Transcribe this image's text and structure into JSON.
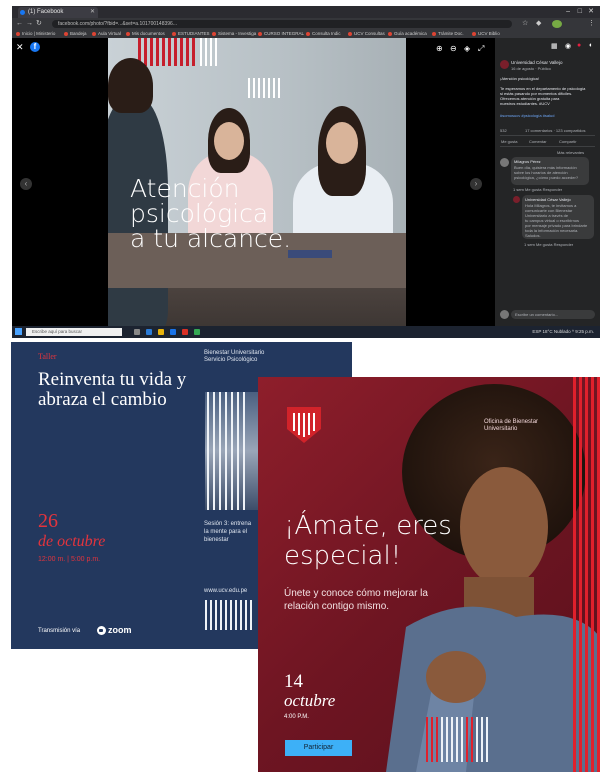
{
  "browser": {
    "tab_title": "(1) Facebook",
    "url": "facebook.com/photo/?fbid=...&set=a.101700148396...",
    "bookmarks": [
      "Inicio | Ministerio",
      "Bandeja",
      "Aula Virtual",
      "Mis documentos",
      "ESTUDIANTES",
      "Sistema - Investiga",
      "CURSO INTEGRAL",
      "Consulta Indic",
      "UCV Consultas",
      "Guía académica",
      "Trámite Doc.",
      "UCV Biblio"
    ]
  },
  "viewer": {
    "headline_lines": [
      "Atención",
      "psicológica",
      "a tu alcance."
    ],
    "close_glyph": "✕",
    "prev_glyph": "‹",
    "next_glyph": "›"
  },
  "sidebar": {
    "page_name": "Universidad César Vallejo",
    "date": "16 de agosto · Público",
    "caption_1": "¡Atención psicológica!",
    "caption_lines": [
      "Te esperamos en el departamento de psicología",
      "si estás pasando por momentos difíciles.",
      "Ofrecemos atención gratuita para",
      "nuestros estudiantes. #UCV"
    ],
    "caption_3": "#somosucv #psicología #salud",
    "reactions": "532",
    "shares": "17 comentarios · 123 compartidos",
    "actions": [
      "Me gusta",
      "Comentar",
      "Compartir"
    ],
    "sort": "Más relevantes",
    "comment_1_author": "Milagros Pérez",
    "comment_1_lines": [
      "Buen día, quisiera más información",
      "sobre los horarios de atención",
      "psicológica, ¿cómo puedo acceder?"
    ],
    "comment_1_meta": "1 sem  Me gusta  Responder",
    "reply_author": "Universidad César Vallejo",
    "reply_lines": [
      "Hola Milagros, te invitamos a",
      "comunicarte con Bienestar",
      "Universitario a través de",
      "tu campus virtual o escribirnos",
      "por mensaje privado para brindarte",
      "toda la información necesaria.",
      "Saludos."
    ],
    "reply_meta": "1 sem  Me gusta  Responder",
    "comment_box": "Escribe un comentario..."
  },
  "taskbar": {
    "search_placeholder": "Escribe aquí para buscar",
    "tray_text": "ESP  18°C  Nublado  ^  9:25 p.m."
  },
  "poster_1": {
    "label": "Taller",
    "title": "Reinventa tu vida y abraza el cambio",
    "org_lines": [
      "Bienestar Universitario",
      "Servicio Psicológico"
    ],
    "day": "26",
    "month": "de octubre",
    "time": "12:00 m. | 5:00 p.m.",
    "session_lines": [
      "Sesión 3: entrena",
      "la mente para el",
      "bienestar"
    ],
    "website": "www.ucv.edu.pe",
    "transmission": "Transmisión vía",
    "zoom": "zoom"
  },
  "poster_2": {
    "org_lines": [
      "Oficina de Bienestar",
      "Universitario"
    ],
    "title": "¡Ámate, eres especial!",
    "subtitle": "Únete y conoce cómo mejorar la relación contigo mismo.",
    "day": "14",
    "month": "octubre",
    "time": "4:00 P.M.",
    "button": "Participar"
  }
}
